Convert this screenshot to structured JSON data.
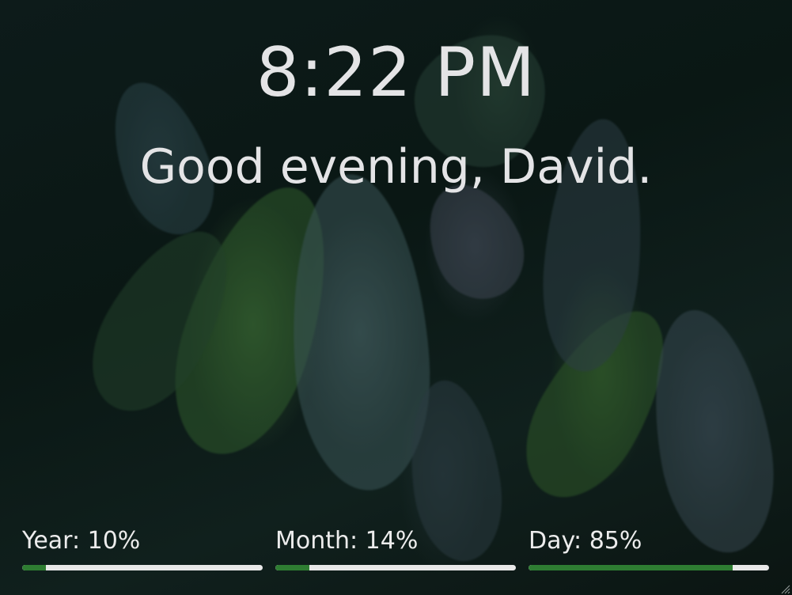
{
  "clock": {
    "time": "8:22 PM"
  },
  "greeting": {
    "text": "Good evening, David."
  },
  "progress": [
    {
      "label": "Year: 10%",
      "value": 0.1
    },
    {
      "label": "Month: 14%",
      "value": 0.14
    },
    {
      "label": "Day: 85%",
      "value": 0.85
    }
  ],
  "colors": {
    "fill": "#2e7d32",
    "track": "#e8e8e8",
    "text": "#e4e4e6"
  },
  "icons": {
    "resize": "resize-grip-icon"
  }
}
